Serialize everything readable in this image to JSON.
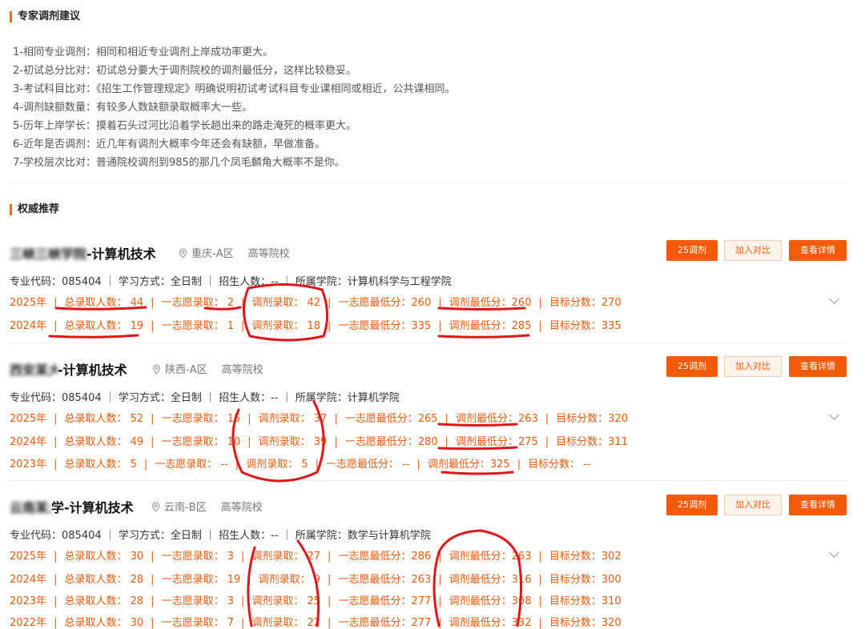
{
  "advice": {
    "title": "专家调剂建议",
    "items": [
      "1-相同专业调剂：相同和相近专业调剂上岸成功率更大。",
      "2-初试总分比对：初试总分要大于调剂院校的调剂最低分，这样比较稳妥。",
      "3-考试科目比对：《招生工作管理规定》明确说明初试考试科目专业课相同或相近，公共课相同。",
      "4-调剂缺额数量：有较多人数缺额录取概率大一些。",
      "5-历年上岸学长：摸着石头过河比沿着学长趟出来的路走淹死的概率更大。",
      "6-近年是否调剂：近几年有调剂大概率今年还会有缺额，早做准备。",
      "7-学校层次比对：普通院校调剂到985的那几个凤毛麟角大概率不是你。"
    ]
  },
  "recommend": {
    "title": "权威推荐"
  },
  "buttons": {
    "adjust": "25调剂",
    "compare": "加入对比",
    "detail": "查看详情"
  },
  "cards": [
    {
      "name_hidden": "三峡三峡学院",
      "name_suffix": "-计算机技术",
      "location": "重庆-A区",
      "level": "高等院校",
      "info": "专业代码：085404 ｜ 学习方式：全日制 ｜ 招生人数：-- ｜ 所属学院：计算机科学与工程学院",
      "rows": [
        [
          "2025年",
          "总录取人数： 44",
          "一志愿录取： 2",
          "调剂录取： 42",
          "一志愿最低分：260",
          "调剂最低分：260",
          "目标分数：270"
        ],
        [
          "2024年",
          "总录取人数： 19",
          "一志愿录取： 1",
          "调剂录取： 18",
          "一志愿最低分：335",
          "调剂最低分：285",
          "目标分数：335"
        ]
      ]
    },
    {
      "name_hidden": "西安某大学",
      "name_suffix": "-计算机技术",
      "location": "陕西-A区",
      "level": "高等院校",
      "info": "专业代码：085404 ｜ 学习方式：全日制 ｜ 招生人数：-- ｜ 所属学院：计算机学院",
      "rows": [
        [
          "2025年",
          "总录取人数： 52",
          "一志愿录取： 15",
          "调剂录取： 37",
          "一志愿最低分：265",
          "调剂最低分：263",
          "目标分数：320"
        ],
        [
          "2024年",
          "总录取人数： 49",
          "一志愿录取： 10",
          "调剂录取： 39",
          "一志愿最低分：280",
          "调剂最低分：275",
          "目标分数：311"
        ],
        [
          "2023年",
          "总录取人数： 5",
          "一志愿录取： --",
          "调剂录取： 5",
          "一志愿最低分： --",
          "调剂最低分：325",
          "目标分数： --"
        ]
      ]
    },
    {
      "name_hidden": "云南某大",
      "name_suffix": "学-计算机技术",
      "location": "云南-B区",
      "level": "高等院校",
      "info": "专业代码：085404 ｜ 学习方式：全日制 ｜ 招生人数：-- ｜ 所属学院：数学与计算机学院",
      "rows": [
        [
          "2025年",
          "总录取人数： 30",
          "一志愿录取： 3",
          "调剂录取： 27",
          "一志愿最低分：286",
          "调剂最低分：263",
          "目标分数：302"
        ],
        [
          "2024年",
          "总录取人数： 28",
          "一志愿录取： 19",
          "调剂录取： 9",
          "一志愿最低分：263",
          "调剂最低分：316",
          "目标分数：300"
        ],
        [
          "2023年",
          "总录取人数： 28",
          "一志愿录取： 3",
          "调剂录取： 25",
          "一志愿最低分：277",
          "调剂最低分：308",
          "目标分数：310"
        ],
        [
          "2022年",
          "总录取人数： 30",
          "一志愿录取： 7",
          "调剂录取： 22",
          "一志愿最低分：277",
          "调剂最低分：332",
          "目标分数：320"
        ]
      ]
    }
  ],
  "colors": {
    "accent": "#f55a09",
    "marker": "#e0161b"
  }
}
